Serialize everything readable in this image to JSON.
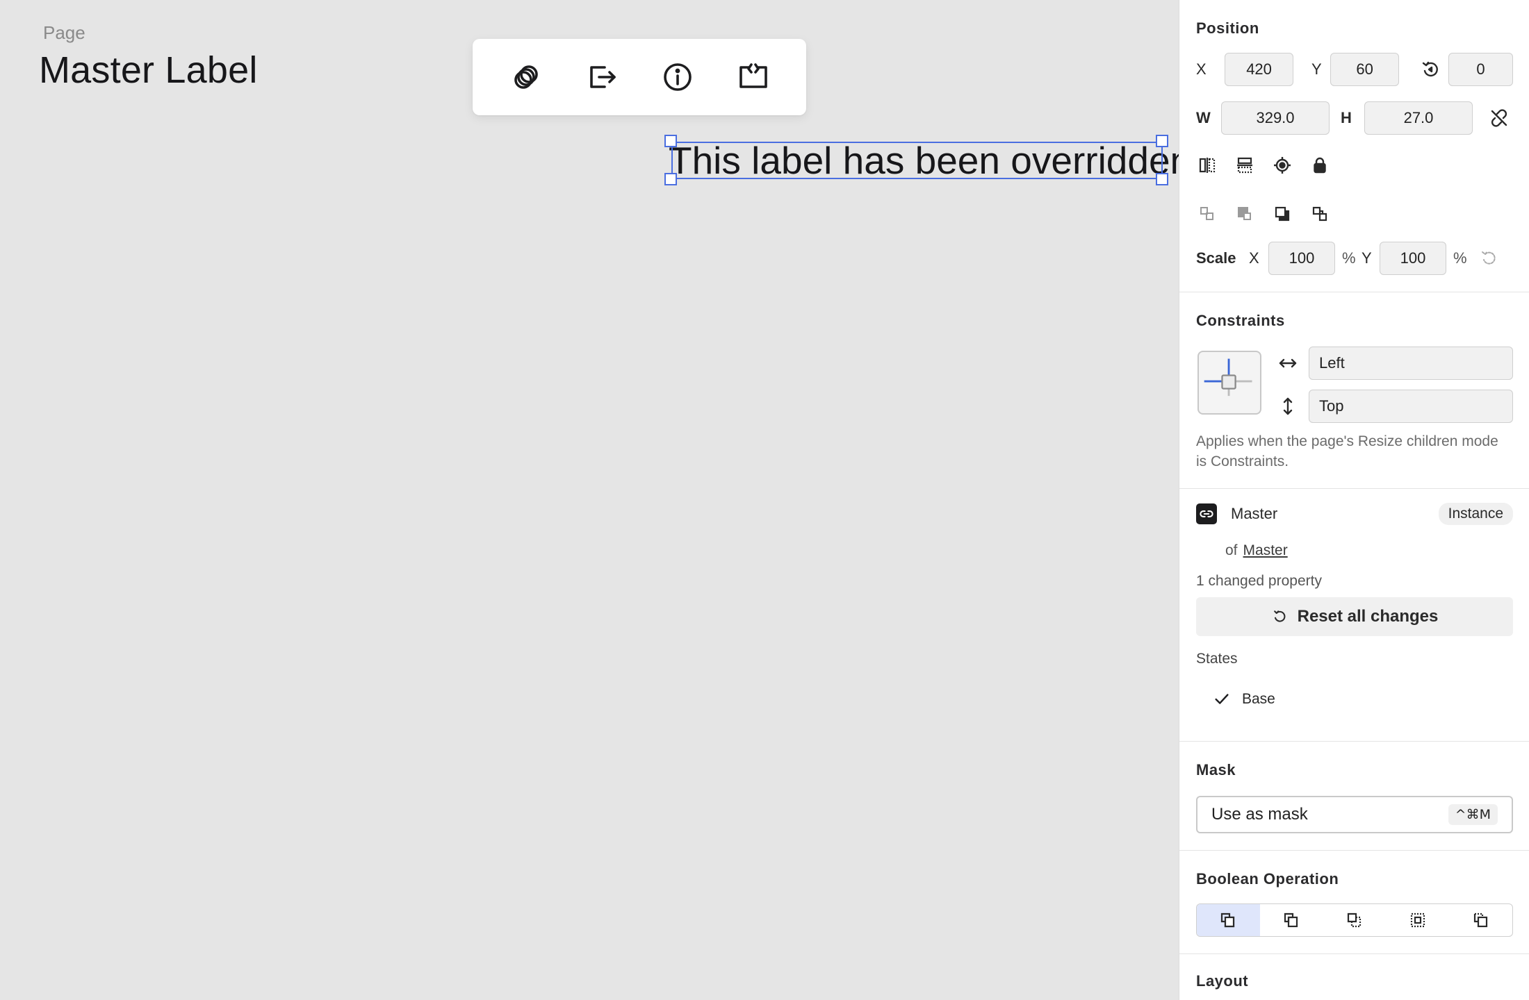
{
  "canvas": {
    "page_label": "Page",
    "page_title": "Master Label",
    "selected_text": "This label has been overridden",
    "toolbar": [
      {
        "name": "link-rings-icon"
      },
      {
        "name": "exit-icon"
      },
      {
        "name": "info-icon"
      },
      {
        "name": "code-frame-icon"
      }
    ],
    "accent_color": "#4a6ee0"
  },
  "inspector": {
    "position": {
      "title": "Position",
      "x_label": "X",
      "x_value": "420",
      "y_label": "Y",
      "y_value": "60",
      "rotation_value": "0",
      "w_label": "W",
      "w_value": "329.0",
      "h_label": "H",
      "h_value": "27.0",
      "scale_label": "Scale",
      "scale_x_label": "X",
      "scale_x_value": "100",
      "scale_x_unit": "%",
      "scale_y_label": "Y",
      "scale_y_value": "100",
      "scale_y_unit": "%"
    },
    "constraints": {
      "title": "Constraints",
      "horizontal_value": "Left",
      "vertical_value": "Top",
      "note": "Applies when the page's Resize children mode is Constraints."
    },
    "component": {
      "name": "Master",
      "badge": "Instance",
      "of_label": "of",
      "of_link": "Master",
      "changed_label": "1 changed property",
      "reset_label": "Reset all changes",
      "states_label": "States",
      "states": [
        "Base"
      ]
    },
    "mask": {
      "title": "Mask",
      "button_label": "Use as mask",
      "shortcut": "^⌘M"
    },
    "boolean": {
      "title": "Boolean Operation"
    },
    "layout": {
      "title": "Layout"
    }
  }
}
